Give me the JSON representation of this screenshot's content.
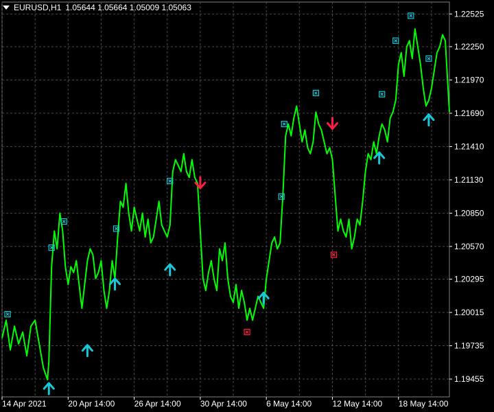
{
  "header": {
    "symbol": "EURUSD,H1",
    "ohlc": "1.05644 1.05664 1.05009 1.05063"
  },
  "colors": {
    "background": "#000000",
    "grid": "#4a4a4a",
    "price_line": "#00ff00",
    "up_signal": "#18c8d8",
    "down_signal": "#ff2040",
    "axis_text": "#ffffff"
  },
  "chart_data": {
    "type": "line",
    "title": "",
    "xlabel": "",
    "ylabel": "",
    "ylim": [
      1.19305,
      1.22625
    ],
    "y_ticks": [
      1.22525,
      1.2225,
      1.2197,
      1.2169,
      1.2141,
      1.2113,
      1.2085,
      1.2057,
      1.20295,
      1.20015,
      1.19735,
      1.19455
    ],
    "y_tick_labels": [
      "1.22525",
      "1.22250",
      "1.21970",
      "1.21690",
      "1.21410",
      "1.21130",
      "1.20850",
      "1.20570",
      "1.20295",
      "1.20015",
      "1.19735",
      "1.19455"
    ],
    "x_range": [
      0,
      325
    ],
    "x_unit": "hourly bars from 14 Apr 2021",
    "x_tick_labels": [
      {
        "bar": 0,
        "label": "14 Apr 2021"
      },
      {
        "bar": 48,
        "label": "20 Apr 14:00"
      },
      {
        "bar": 96,
        "label": "26 Apr 14:00"
      },
      {
        "bar": 144,
        "label": "30 Apr 14:00"
      },
      {
        "bar": 192,
        "label": "6 May 14:00"
      },
      {
        "bar": 240,
        "label": "12 May 14:00"
      },
      {
        "bar": 288,
        "label": "18 May 14:00"
      }
    ],
    "grid": true,
    "series": [
      {
        "points": [
          [
            0,
            1.198
          ],
          [
            3,
            1.1995
          ],
          [
            6,
            1.197
          ],
          [
            9,
            1.199
          ],
          [
            12,
            1.1975
          ],
          [
            15,
            1.1985
          ],
          [
            18,
            1.1965
          ],
          [
            21,
            1.199
          ],
          [
            24,
            1.1995
          ],
          [
            27,
            1.1975
          ],
          [
            30,
            1.1955
          ],
          [
            33,
            1.1945
          ],
          [
            34,
            1.196
          ],
          [
            36,
            1.204
          ],
          [
            38,
            1.207
          ],
          [
            40,
            1.2055
          ],
          [
            42,
            1.2085
          ],
          [
            44,
            1.207
          ],
          [
            46,
            1.204
          ],
          [
            48,
            1.2025
          ],
          [
            50,
            1.204
          ],
          [
            52,
            1.2035
          ],
          [
            54,
            1.2045
          ],
          [
            56,
            1.2025
          ],
          [
            58,
            1.2005
          ],
          [
            60,
            1.2025
          ],
          [
            62,
            1.2045
          ],
          [
            64,
            1.2055
          ],
          [
            66,
            1.205
          ],
          [
            68,
            1.203
          ],
          [
            70,
            1.2035
          ],
          [
            72,
            1.2045
          ],
          [
            74,
            1.202
          ],
          [
            76,
            1.2005
          ],
          [
            78,
            1.202
          ],
          [
            80,
            1.2045
          ],
          [
            82,
            1.203
          ],
          [
            84,
            1.2065
          ],
          [
            86,
            1.2095
          ],
          [
            88,
            1.209
          ],
          [
            90,
            1.211
          ],
          [
            92,
            1.2085
          ],
          [
            94,
            1.207
          ],
          [
            96,
            1.209
          ],
          [
            98,
            1.208
          ],
          [
            100,
            1.207
          ],
          [
            102,
            1.2085
          ],
          [
            104,
            1.2065
          ],
          [
            106,
            1.208
          ],
          [
            108,
            1.206
          ],
          [
            110,
            1.2065
          ],
          [
            112,
            1.208
          ],
          [
            114,
            1.2095
          ],
          [
            116,
            1.2075
          ],
          [
            118,
            1.207
          ],
          [
            120,
            1.2065
          ],
          [
            122,
            1.2075
          ],
          [
            124,
            1.212
          ],
          [
            126,
            1.213
          ],
          [
            128,
            1.2125
          ],
          [
            130,
            1.212
          ],
          [
            132,
            1.2135
          ],
          [
            134,
            1.212
          ],
          [
            136,
            1.2115
          ],
          [
            138,
            1.213
          ],
          [
            140,
            1.2115
          ],
          [
            142,
            1.211
          ],
          [
            144,
            1.207
          ],
          [
            146,
            1.203
          ],
          [
            148,
            1.202
          ],
          [
            150,
            1.2035
          ],
          [
            152,
            1.2045
          ],
          [
            154,
            1.203
          ],
          [
            156,
            1.202
          ],
          [
            158,
            1.2055
          ],
          [
            160,
            1.2045
          ],
          [
            162,
            1.206
          ],
          [
            164,
            1.203
          ],
          [
            166,
            1.2015
          ],
          [
            168,
            1.201
          ],
          [
            170,
            1.2025
          ],
          [
            172,
            1.2005
          ],
          [
            174,
            1.202
          ],
          [
            176,
            1.201
          ],
          [
            178,
            1.1995
          ],
          [
            180,
            1.2005
          ],
          [
            182,
            1.1995
          ],
          [
            184,
            1.2005
          ],
          [
            186,
            1.2015
          ],
          [
            188,
            1.201
          ],
          [
            190,
            1.2005
          ],
          [
            192,
            1.203
          ],
          [
            194,
            1.2045
          ],
          [
            196,
            1.206
          ],
          [
            198,
            1.2065
          ],
          [
            200,
            1.2055
          ],
          [
            202,
            1.206
          ],
          [
            204,
            1.21
          ],
          [
            206,
            1.215
          ],
          [
            208,
            1.216
          ],
          [
            210,
            1.215
          ],
          [
            212,
            1.2165
          ],
          [
            214,
            1.2175
          ],
          [
            216,
            1.216
          ],
          [
            218,
            1.2145
          ],
          [
            220,
            1.2155
          ],
          [
            222,
            1.214
          ],
          [
            224,
            1.2135
          ],
          [
            226,
            1.2145
          ],
          [
            228,
            1.217
          ],
          [
            230,
            1.216
          ],
          [
            232,
            1.2155
          ],
          [
            234,
            1.2145
          ],
          [
            236,
            1.2135
          ],
          [
            238,
            1.214
          ],
          [
            240,
            1.213
          ],
          [
            242,
            1.21
          ],
          [
            244,
            1.207
          ],
          [
            246,
            1.208
          ],
          [
            248,
            1.207
          ],
          [
            250,
            1.2065
          ],
          [
            252,
            1.208
          ],
          [
            254,
            1.2055
          ],
          [
            256,
            1.2065
          ],
          [
            258,
            1.208
          ],
          [
            260,
            1.2075
          ],
          [
            262,
            1.2095
          ],
          [
            264,
            1.212
          ],
          [
            266,
            1.2135
          ],
          [
            268,
            1.213
          ],
          [
            270,
            1.2145
          ],
          [
            272,
            1.2135
          ],
          [
            274,
            1.215
          ],
          [
            276,
            1.216
          ],
          [
            278,
            1.2155
          ],
          [
            280,
            1.2145
          ],
          [
            282,
            1.2165
          ],
          [
            284,
            1.217
          ],
          [
            286,
            1.218
          ],
          [
            288,
            1.221
          ],
          [
            290,
            1.222
          ],
          [
            292,
            1.22
          ],
          [
            294,
            1.2225
          ],
          [
            296,
            1.223
          ],
          [
            298,
            1.2215
          ],
          [
            300,
            1.224
          ],
          [
            302,
            1.2225
          ],
          [
            304,
            1.221
          ],
          [
            306,
            1.219
          ],
          [
            308,
            1.2175
          ],
          [
            310,
            1.218
          ],
          [
            312,
            1.219
          ],
          [
            314,
            1.2205
          ],
          [
            316,
            1.222
          ],
          [
            318,
            1.2225
          ],
          [
            320,
            1.2235
          ],
          [
            322,
            1.223
          ],
          [
            324,
            1.219
          ],
          [
            325,
            1.217
          ]
        ]
      }
    ],
    "up_arrows": [
      [
        34,
        1.1938
      ],
      [
        62,
        1.197
      ],
      [
        82,
        1.2026
      ],
      [
        122,
        1.2038
      ],
      [
        190,
        1.2014
      ],
      [
        274,
        1.2132
      ],
      [
        310,
        1.2164
      ]
    ],
    "down_arrows": [
      [
        144,
        1.211
      ],
      [
        240,
        1.216
      ]
    ],
    "up_markers": [
      [
        4,
        1.2
      ],
      [
        36,
        1.2056
      ],
      [
        45,
        1.2078
      ],
      [
        83,
        1.2072
      ],
      [
        122,
        1.2112
      ],
      [
        203,
        1.2099
      ],
      [
        205,
        1.216
      ],
      [
        228,
        1.2186
      ],
      [
        276,
        1.2185
      ],
      [
        297,
        1.2251
      ],
      [
        286,
        1.223
      ],
      [
        310,
        1.2215
      ]
    ],
    "down_markers": [
      [
        178,
        1.1985
      ],
      [
        241,
        1.205
      ]
    ]
  }
}
